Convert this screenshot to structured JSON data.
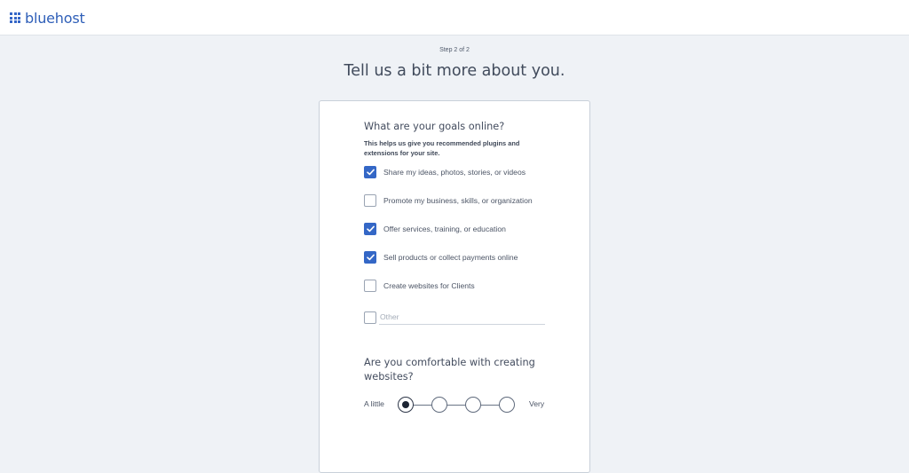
{
  "header": {
    "brand": "bluehost"
  },
  "step": "Step 2 of 2",
  "headline": "Tell us a bit more about you.",
  "goals": {
    "title": "What are your goals online?",
    "help": "This helps us give you recommended plugins and extensions for your site.",
    "options": [
      {
        "label": "Share my ideas, photos, stories, or videos",
        "checked": true
      },
      {
        "label": "Promote my business, skills, or organization",
        "checked": false
      },
      {
        "label": "Offer services, training, or education",
        "checked": true
      },
      {
        "label": "Sell products or collect payments online",
        "checked": true
      },
      {
        "label": "Create websites for Clients",
        "checked": false
      }
    ],
    "other": {
      "placeholder": "Other",
      "value": "",
      "checked": false
    }
  },
  "comfort": {
    "title": "Are you comfortable with creating websites?",
    "min_label": "A little",
    "max_label": "Very",
    "levels": 4,
    "selected": 1
  },
  "colors": {
    "accent": "#3467c6",
    "brand": "#2f5fb8",
    "background": "#eff2f6"
  }
}
